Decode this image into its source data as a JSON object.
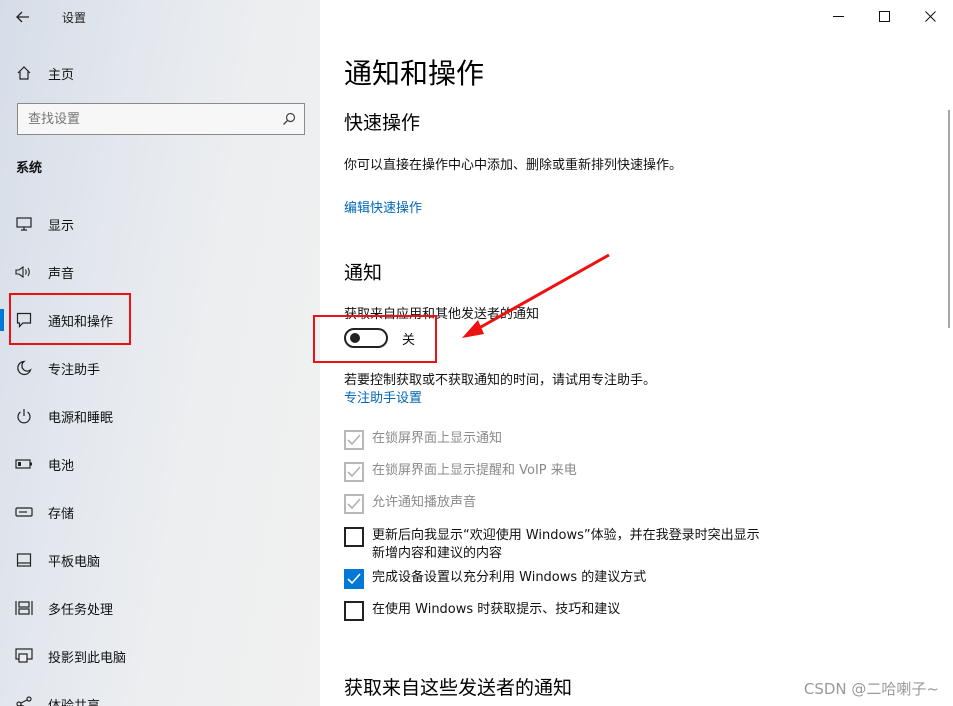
{
  "app": {
    "title": "设置"
  },
  "sidebar": {
    "home_label": "主页",
    "search_placeholder": "查找设置",
    "section": "系统",
    "items": [
      {
        "label": "显示",
        "icon": "monitor-icon"
      },
      {
        "label": "声音",
        "icon": "speaker-icon"
      },
      {
        "label": "通知和操作",
        "icon": "notification-icon"
      },
      {
        "label": "专注助手",
        "icon": "moon-icon"
      },
      {
        "label": "电源和睡眠",
        "icon": "power-icon"
      },
      {
        "label": "电池",
        "icon": "battery-icon"
      },
      {
        "label": "存储",
        "icon": "storage-icon"
      },
      {
        "label": "平板电脑",
        "icon": "tablet-icon"
      },
      {
        "label": "多任务处理",
        "icon": "multitask-icon"
      },
      {
        "label": "投影到此电脑",
        "icon": "project-icon"
      },
      {
        "label": "体验共享",
        "icon": "share-icon"
      }
    ]
  },
  "main": {
    "title": "通知和操作",
    "quick": {
      "heading": "快速操作",
      "desc": "你可以直接在操作中心中添加、删除或重新排列快速操作。",
      "edit_link": "编辑快速操作"
    },
    "notify": {
      "heading": "通知",
      "toggle_desc": "获取来自应用和其他发送者的通知",
      "toggle_state": "关",
      "focus_desc": "若要控制获取或不获取通知的时间，请试用专注助手。",
      "focus_link": "专注助手设置",
      "checks": [
        {
          "label": "在锁屏界面上显示通知",
          "checked": true,
          "disabled": true
        },
        {
          "label": "在锁屏界面上显示提醒和 VoIP 来电",
          "checked": true,
          "disabled": true
        },
        {
          "label": "允许通知播放声音",
          "checked": true,
          "disabled": true
        },
        {
          "label": "更新后向我显示“欢迎使用 Windows”体验，并在我登录时突出显示",
          "label2": "新增内容和建议的内容",
          "checked": false,
          "disabled": false
        },
        {
          "label": "完成设备设置以充分利用 Windows 的建议方式",
          "checked": true,
          "disabled": false
        },
        {
          "label": "在使用 Windows 时获取提示、技巧和建议",
          "checked": false,
          "disabled": false
        }
      ]
    },
    "senders": {
      "heading": "获取来自这些发送者的通知"
    }
  },
  "watermark": "CSDN @二哈喇子~",
  "colors": {
    "accent": "#0078d7",
    "link": "#0067b8",
    "annotation_red": "#e11"
  }
}
